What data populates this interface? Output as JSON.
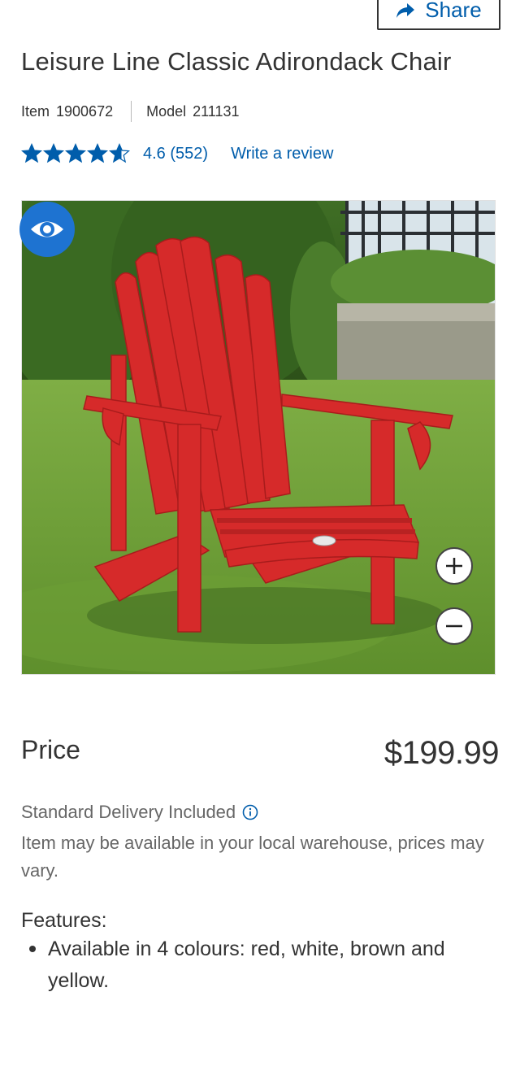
{
  "header": {
    "share_label": "Share"
  },
  "product": {
    "title": "Leisure Line Classic Adirondack Chair",
    "item_label": "Item",
    "item_number": "1900672",
    "model_label": "Model",
    "model_number": "211131",
    "rating_value": 4.6,
    "rating_text": "4.6 (552)",
    "write_review_label": "Write a review",
    "image_alt": "Red Adirondack chair on a lawn"
  },
  "pricing": {
    "price_label": "Price",
    "price_value": "$199.99",
    "delivery_text": "Standard Delivery Included",
    "availability_text": "Item may be available in your local warehouse, prices may vary."
  },
  "features": {
    "heading": "Features:",
    "items": [
      "Available in 4 colours: red, white, brown and yellow."
    ]
  },
  "icons": {
    "share": "share-arrow-icon",
    "star": "star-icon",
    "view": "eye-icon",
    "zoom_in": "plus-icon",
    "zoom_out": "minus-icon",
    "info": "info-icon"
  },
  "colors": {
    "link": "#005dab",
    "star": "#005dab",
    "view_button": "#1e73d1",
    "chair": "#d62a2a",
    "text": "#333333",
    "muted_text": "#666666"
  }
}
